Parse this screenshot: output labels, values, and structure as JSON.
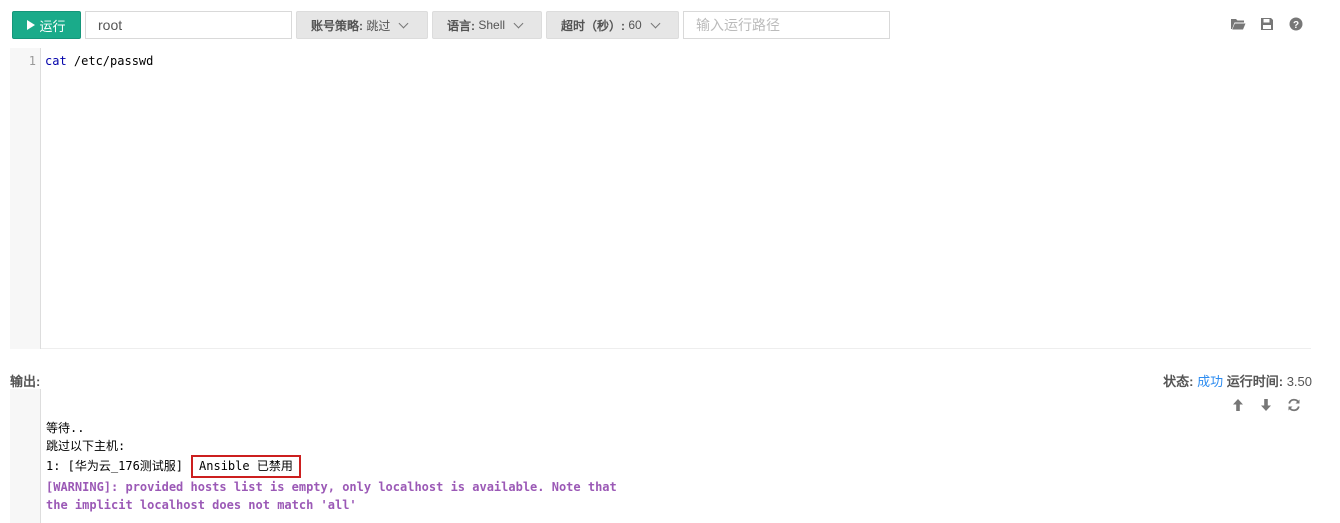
{
  "toolbar": {
    "run_label": "运行",
    "user_value": "root",
    "policy": {
      "label": "账号策略:",
      "value": "跳过"
    },
    "language": {
      "label": "语言:",
      "value": "Shell"
    },
    "timeout": {
      "label": "超时（秒）:",
      "value": "60"
    },
    "path_placeholder": "输入运行路径",
    "icons": [
      "folder-open-icon",
      "save-icon",
      "help-icon"
    ]
  },
  "editor": {
    "line_number": "1",
    "code_cmd": "cat",
    "code_arg": " /etc/passwd"
  },
  "output": {
    "label": "输出:",
    "status_label": "状态:",
    "status_value": "成功",
    "runtime_label": "运行时间:",
    "runtime_value": "3.50",
    "icons": [
      "arrow-up-icon",
      "arrow-down-icon",
      "refresh-icon"
    ],
    "lines": {
      "waiting": "等待..",
      "skip": "跳过以下主机:",
      "host": "1: [华为云_176测试服]",
      "badge": "Ansible 已禁用",
      "warn1": "[WARNING]: provided hosts list is empty, only localhost is available. Note that",
      "warn2": "the implicit localhost does not match 'all'"
    }
  },
  "colors": {
    "run_button": "#1aab8a",
    "status_success": "#2d8cf0",
    "warning_text": "#9b59b6",
    "badge_border": "#cc1f1f"
  }
}
